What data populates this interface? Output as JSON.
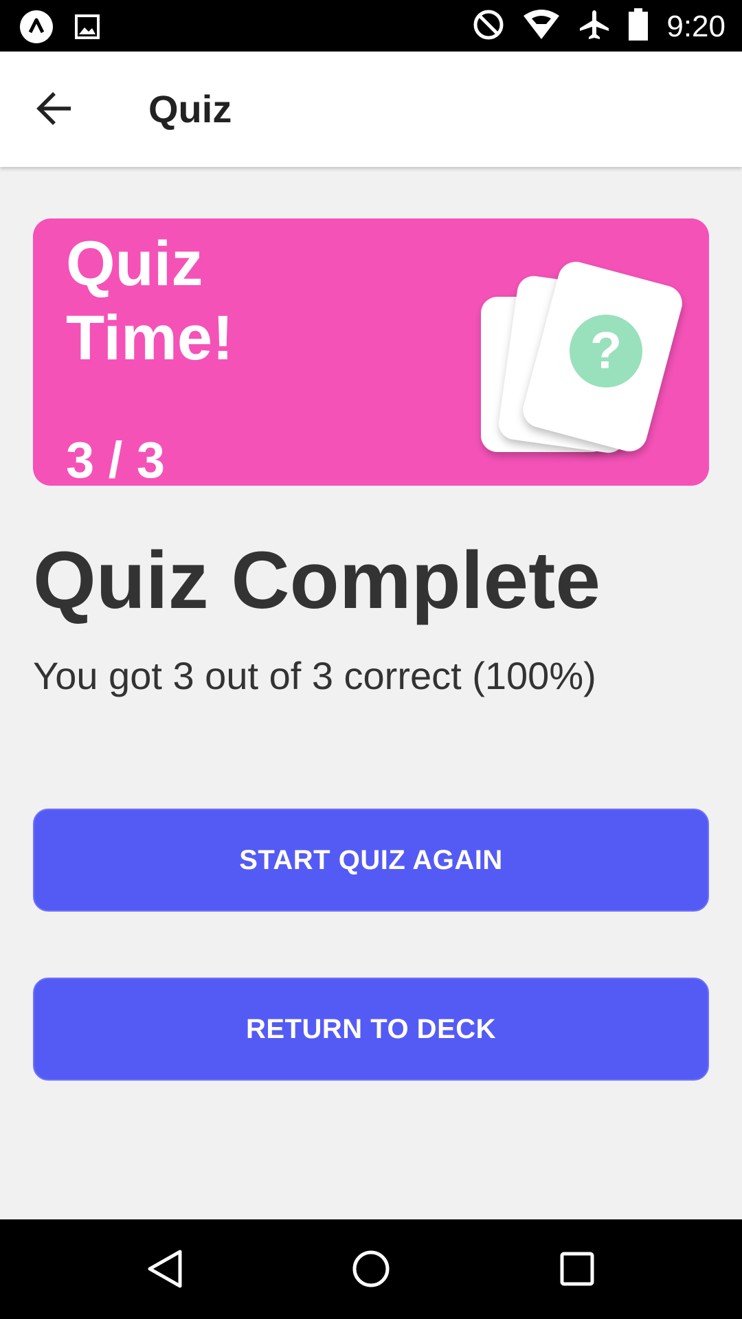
{
  "status_bar": {
    "time": "9:20",
    "icons": [
      "app-badge-icon",
      "image-notification-icon",
      "do-not-disturb-icon",
      "wifi-icon",
      "airplane-icon",
      "battery-icon"
    ]
  },
  "app_bar": {
    "title": "Quiz",
    "back_icon": "arrow-back-icon"
  },
  "banner": {
    "title": "Quiz Time!",
    "progress": "3 / 3",
    "background_color": "#f552b8",
    "illustration_icon": "question-cards-icon",
    "accent_color": "#99e0bc"
  },
  "result": {
    "heading": "Quiz Complete",
    "summary": "You got 3 out of 3 correct (100%)",
    "score_correct": 3,
    "score_total": 3,
    "percent": 100
  },
  "actions": {
    "start_again_label": "START QUIZ AGAIN",
    "return_label": "RETURN TO DECK",
    "button_color": "#545bf4"
  },
  "nav_bar": {
    "icons": [
      "nav-back-icon",
      "nav-home-icon",
      "nav-recents-icon"
    ]
  }
}
